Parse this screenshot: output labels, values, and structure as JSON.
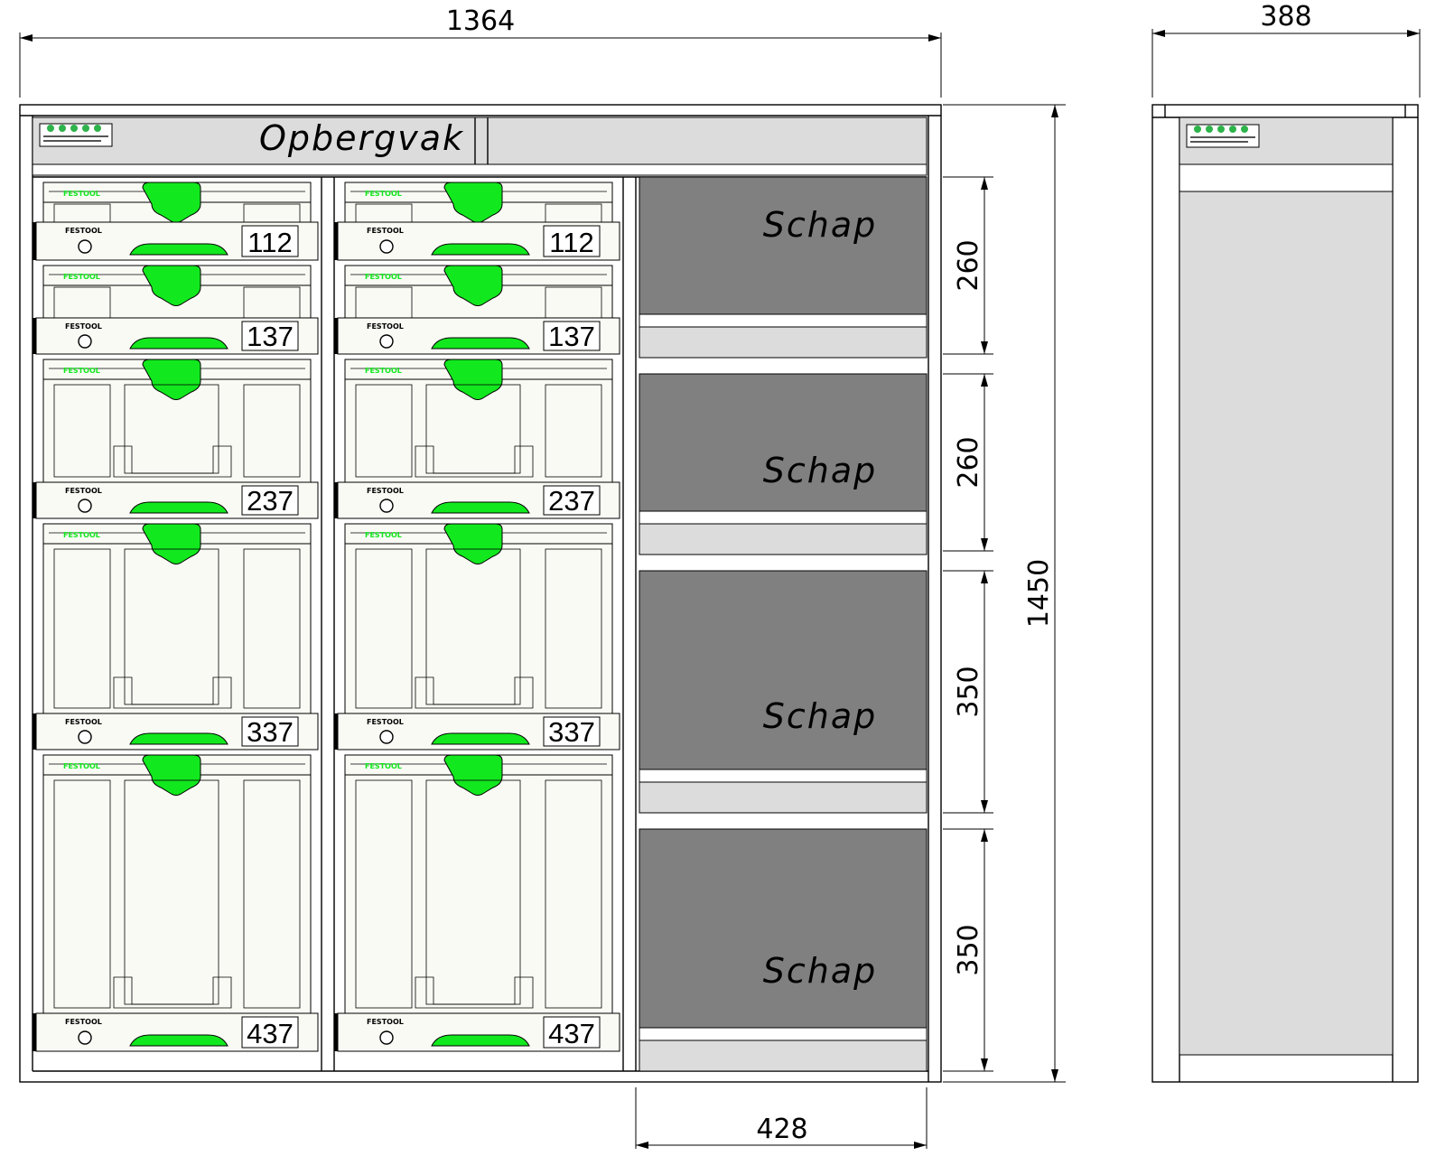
{
  "dimensions": {
    "total_width": "1364",
    "depth": "388",
    "total_height": "1450",
    "shelf_width": "428",
    "shelf_heights": [
      "260",
      "260",
      "350",
      "350"
    ]
  },
  "top_compartment": {
    "label": "Opbergvak"
  },
  "shelves": [
    {
      "label": "Schap"
    },
    {
      "label": "Schap"
    },
    {
      "label": "Schap"
    },
    {
      "label": "Schap"
    }
  ],
  "systainers": [
    {
      "size": "112"
    },
    {
      "size": "137"
    },
    {
      "size": "237"
    },
    {
      "size": "337"
    },
    {
      "size": "437"
    }
  ],
  "brand": "FESTOOL",
  "colors": {
    "festool_green": "#12e81e",
    "shelf_gray": "#808080",
    "panel_gray": "#dcdcdc",
    "systainer_body": "#fafaf5"
  }
}
